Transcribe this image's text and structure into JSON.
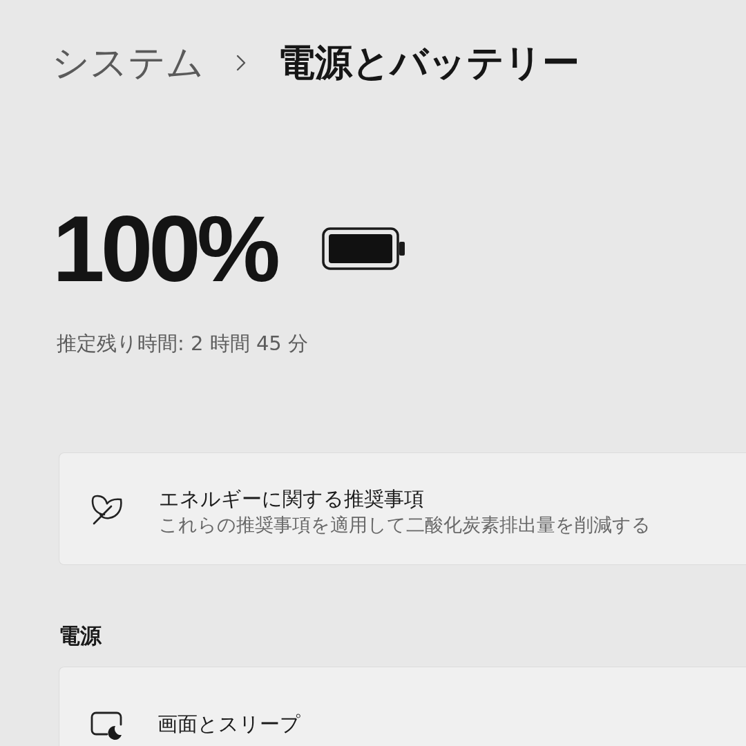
{
  "breadcrumb": {
    "parent": "システム",
    "current": "電源とバッテリー"
  },
  "battery": {
    "percentage": "100%",
    "estimate": "推定残り時間: 2 時間 45 分"
  },
  "recommendation_card": {
    "title": "エネルギーに関する推奨事項",
    "description": "これらの推奨事項を適用して二酸化炭素排出量を削減する"
  },
  "power_section": {
    "heading": "電源",
    "items": [
      {
        "title": "画面とスリープ"
      }
    ]
  }
}
